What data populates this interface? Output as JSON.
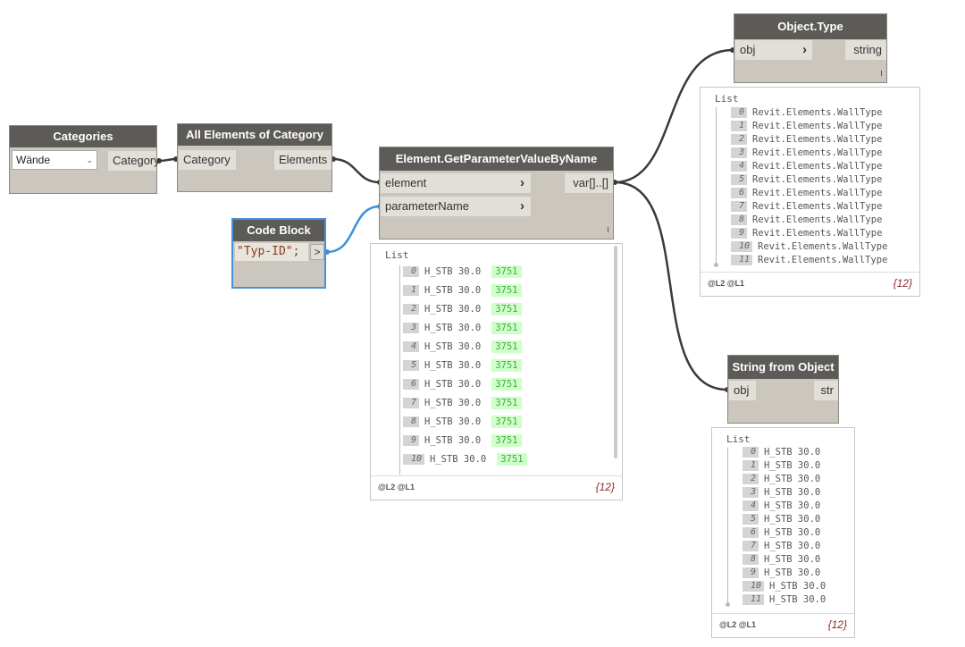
{
  "nodes": {
    "categories": {
      "title": "Categories",
      "dropdown_value": "Wände",
      "output": "Category"
    },
    "all_elements": {
      "title": "All Elements of Category",
      "input": "Category",
      "output": "Elements"
    },
    "get_param": {
      "title": "Element.GetParameterValueByName",
      "input_1": "element",
      "input_2": "parameterName",
      "output": "var[]..[]"
    },
    "code_block": {
      "title": "Code Block",
      "code": "\"Typ-ID\";",
      "output": ">"
    },
    "object_type": {
      "title": "Object.Type",
      "input": "obj",
      "output": "string"
    },
    "string_from_object": {
      "title": "String from Object",
      "input": "obj",
      "output": "str"
    }
  },
  "previews": {
    "get_param": {
      "title": "List",
      "levels": "@L2 @L1",
      "count": "{12}",
      "rows": [
        {
          "i": "0",
          "v": "H_STB 30.0",
          "n": "3751"
        },
        {
          "i": "1",
          "v": "H_STB 30.0",
          "n": "3751"
        },
        {
          "i": "2",
          "v": "H_STB 30.0",
          "n": "3751"
        },
        {
          "i": "3",
          "v": "H_STB 30.0",
          "n": "3751"
        },
        {
          "i": "4",
          "v": "H_STB 30.0",
          "n": "3751"
        },
        {
          "i": "5",
          "v": "H_STB 30.0",
          "n": "3751"
        },
        {
          "i": "6",
          "v": "H_STB 30.0",
          "n": "3751"
        },
        {
          "i": "7",
          "v": "H_STB 30.0",
          "n": "3751"
        },
        {
          "i": "8",
          "v": "H_STB 30.0",
          "n": "3751"
        },
        {
          "i": "9",
          "v": "H_STB 30.0",
          "n": "3751"
        },
        {
          "i": "10",
          "v": "H_STB 30.0",
          "n": "3751"
        }
      ]
    },
    "object_type": {
      "title": "List",
      "levels": "@L2 @L1",
      "count": "{12}",
      "rows": [
        {
          "i": "0",
          "v": "Revit.Elements.WallType"
        },
        {
          "i": "1",
          "v": "Revit.Elements.WallType"
        },
        {
          "i": "2",
          "v": "Revit.Elements.WallType"
        },
        {
          "i": "3",
          "v": "Revit.Elements.WallType"
        },
        {
          "i": "4",
          "v": "Revit.Elements.WallType"
        },
        {
          "i": "5",
          "v": "Revit.Elements.WallType"
        },
        {
          "i": "6",
          "v": "Revit.Elements.WallType"
        },
        {
          "i": "7",
          "v": "Revit.Elements.WallType"
        },
        {
          "i": "8",
          "v": "Revit.Elements.WallType"
        },
        {
          "i": "9",
          "v": "Revit.Elements.WallType"
        },
        {
          "i": "10",
          "v": "Revit.Elements.WallType"
        },
        {
          "i": "11",
          "v": "Revit.Elements.WallType"
        }
      ]
    },
    "string_from_object": {
      "title": "List",
      "levels": "@L2 @L1",
      "count": "{12}",
      "rows": [
        {
          "i": "0",
          "v": "H_STB 30.0"
        },
        {
          "i": "1",
          "v": "H_STB 30.0"
        },
        {
          "i": "2",
          "v": "H_STB 30.0"
        },
        {
          "i": "3",
          "v": "H_STB 30.0"
        },
        {
          "i": "4",
          "v": "H_STB 30.0"
        },
        {
          "i": "5",
          "v": "H_STB 30.0"
        },
        {
          "i": "6",
          "v": "H_STB 30.0"
        },
        {
          "i": "7",
          "v": "H_STB 30.0"
        },
        {
          "i": "8",
          "v": "H_STB 30.0"
        },
        {
          "i": "9",
          "v": "H_STB 30.0"
        },
        {
          "i": "10",
          "v": "H_STB 30.0"
        },
        {
          "i": "11",
          "v": "H_STB 30.0"
        }
      ]
    }
  },
  "colors": {
    "header": "#5d5b57",
    "node_body": "#cbc6be",
    "selected": "#4a90d9",
    "wire": "#3a3a3a",
    "wire_selected": "#3d8fd6",
    "value_highlight": "#cfffc9"
  }
}
